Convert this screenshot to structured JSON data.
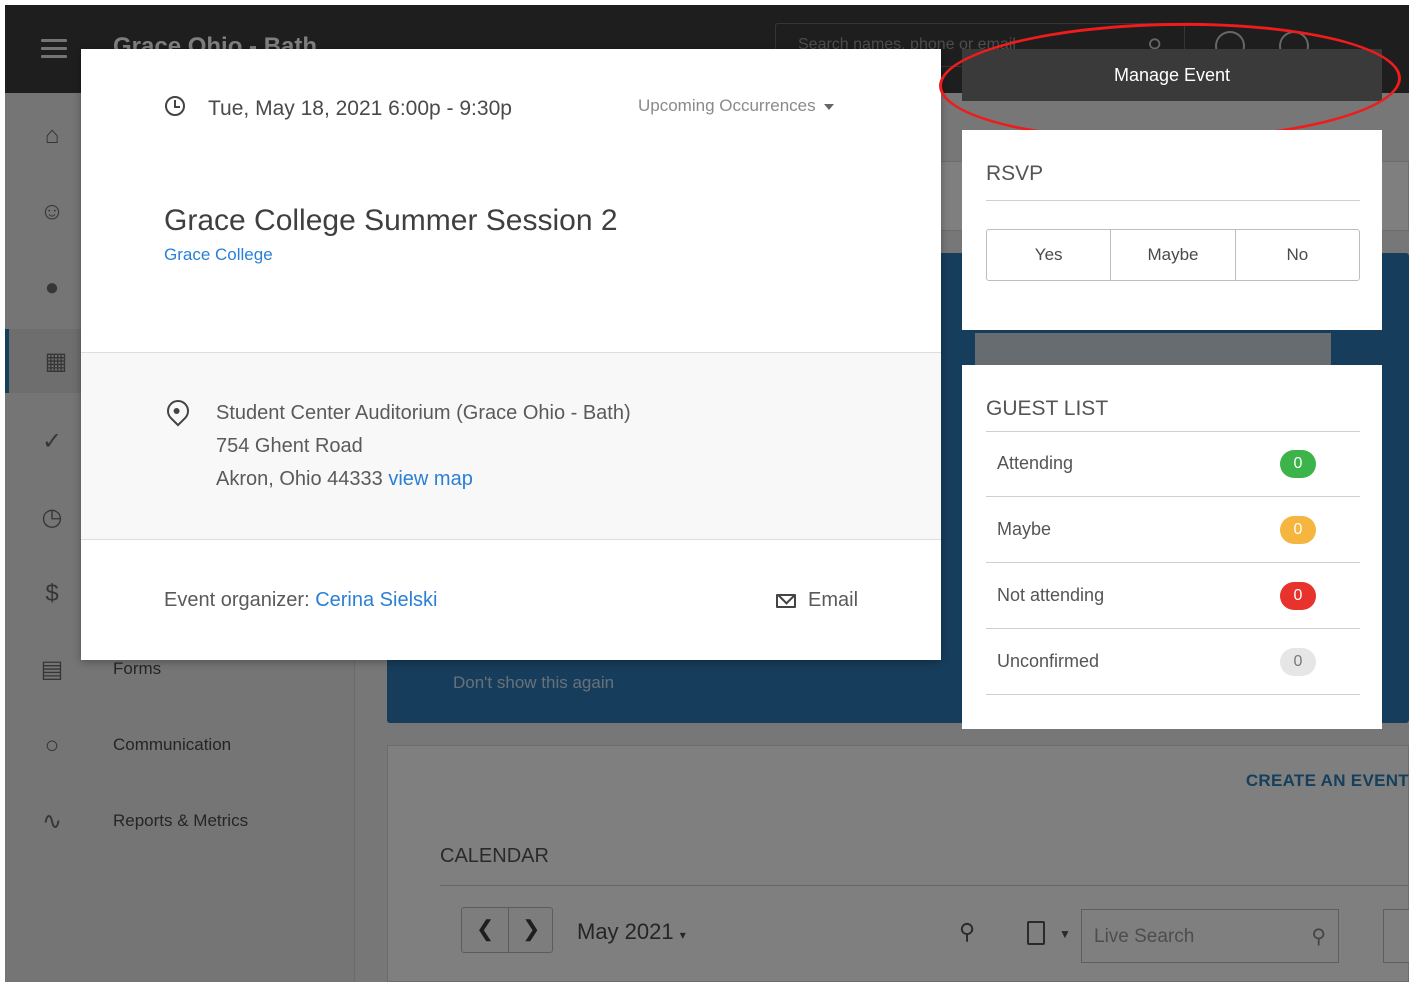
{
  "app": {
    "org_title": "Grace Ohio - Bath",
    "search_placeholder": "Search names, phone or email"
  },
  "sidebar": {
    "items": [
      {
        "icon": "home-icon",
        "label": ""
      },
      {
        "icon": "people-icon",
        "label": ""
      },
      {
        "icon": "groups-icon",
        "label": ""
      },
      {
        "icon": "calendar-icon",
        "label": "",
        "active": true
      },
      {
        "icon": "check-circle-icon",
        "label": ""
      },
      {
        "icon": "clock-icon",
        "label": ""
      },
      {
        "icon": "dollar-icon",
        "label": ""
      },
      {
        "icon": "clipboard-icon",
        "label": "Forms"
      },
      {
        "icon": "chat-icon",
        "label": "Communication"
      },
      {
        "icon": "pulse-icon",
        "label": "Reports & Metrics"
      }
    ]
  },
  "background": {
    "dont_show": "Don't show this again",
    "create_event": "CREATE AN EVENT",
    "calendar_label": "CALENDAR",
    "month": "May 2021",
    "live_search_placeholder": "Live Search"
  },
  "event": {
    "date_time": "Tue, May 18, 2021 6:00p - 9:30p",
    "occurrences_label": "Upcoming Occurrences",
    "title": "Grace College Summer Session 2",
    "group_link": "Grace College",
    "location_name": "Student Center Auditorium (Grace Ohio - Bath)",
    "address_line": "754 Ghent Road",
    "city_line": "Akron, Ohio 44333",
    "view_map": "view map",
    "organizer_label": "Event organizer:",
    "organizer_name": "Cerina Sielski",
    "email_label": "Email"
  },
  "manage": {
    "button_label": "Manage Event"
  },
  "rsvp": {
    "title": "RSVP",
    "options": [
      "Yes",
      "Maybe",
      "No"
    ]
  },
  "guest_list": {
    "title": "GUEST LIST",
    "rows": [
      {
        "label": "Attending",
        "count": "0",
        "color": "#3cb44a"
      },
      {
        "label": "Maybe",
        "count": "0",
        "color": "#f5b53f"
      },
      {
        "label": "Not attending",
        "count": "0",
        "color": "#e8322c"
      },
      {
        "label": "Unconfirmed",
        "count": "0",
        "color": "#e6e6e6"
      }
    ]
  },
  "colors": {
    "link": "#2a7fd6",
    "annotation_circle": "#ee1c1c",
    "manage_button_bg": "#3a3a3a"
  }
}
